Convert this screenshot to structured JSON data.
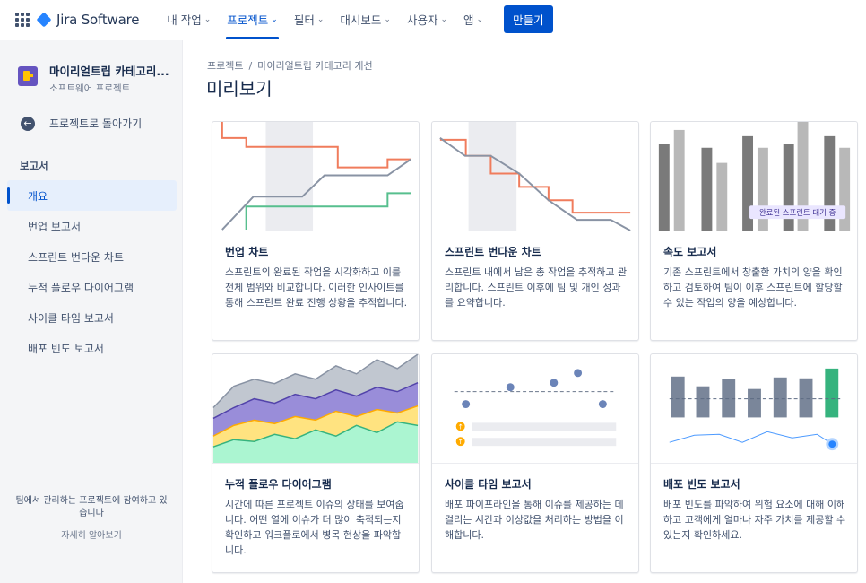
{
  "topnav": {
    "brand": "Jira Software",
    "items": [
      {
        "label": "내 작업",
        "active": false
      },
      {
        "label": "프로젝트",
        "active": true
      },
      {
        "label": "필터",
        "active": false
      },
      {
        "label": "대시보드",
        "active": false
      },
      {
        "label": "사용자",
        "active": false
      },
      {
        "label": "앱",
        "active": false
      }
    ],
    "create_label": "만들기",
    "chevron": "⌄"
  },
  "sidebar": {
    "project_name": "마이리얼트립 카테고리...",
    "project_type": "소프트웨어 프로젝트",
    "back_label": "프로젝트로 돌아가기",
    "section_title": "보고서",
    "items": [
      {
        "label": "개요",
        "active": true
      },
      {
        "label": "번업 보고서",
        "active": false
      },
      {
        "label": "스프린트 번다운 차트",
        "active": false
      },
      {
        "label": "누적 플로우 다이어그램",
        "active": false
      },
      {
        "label": "사이클 타임 보고서",
        "active": false
      },
      {
        "label": "배포 빈도 보고서",
        "active": false
      }
    ],
    "footer_text_1": "팀에서 관리하는 프로젝트에 참여하고 있",
    "footer_text_2": "습니다",
    "footer_link": "자세히 알아보기"
  },
  "main": {
    "breadcrumb": [
      "프로젝트",
      "마이리얼트립 카테고리 개선"
    ],
    "breadcrumb_sep": "/",
    "title": "미리보기"
  },
  "cards": [
    {
      "title": "번업 차트",
      "desc": "스프린트의 완료된 작업을 시각화하고 이를 전체 범위와 비교합니다. 이러한 인사이트를 통해 스프린트 완료 진행 상황을 추적합니다."
    },
    {
      "title": "스프린트 번다운 차트",
      "desc": "스프린트 내에서 남은 총 작업을 추적하고 관리합니다. 스프린트 이후에 팀 및 개인 성과를 요약합니다."
    },
    {
      "title": "속도 보고서",
      "desc": "기존 스프린트에서 창출한 가치의 양을 확인하고 검토하여 팀이 이후 스프린트에 할당할 수 있는 작업의 양을 예상합니다.",
      "badge": "완료된 스프린트 대기 중"
    },
    {
      "title": "누적 플로우 다이어그램",
      "desc": "시간에 따른 프로젝트 이슈의 상태를 보여줍니다. 어떤 열에 이슈가 더 많이 축적되는지 확인하고 워크플로에서 병목 현상을 파악합니다."
    },
    {
      "title": "사이클 타임 보고서",
      "desc": "배포 파이프라인을 통해 이슈를 제공하는 데 걸리는 시간과 이상값을 처리하는 방법을 이해합니다."
    },
    {
      "title": "배포 빈도 보고서",
      "desc": "배포 빈도를 파악하여 위험 요소에 대해 이해하고 고객에게 얼마나 자주 가치를 제공할 수 있는지 확인하세요."
    }
  ],
  "icons": {
    "app_switcher": "grid-icon",
    "back": "arrow-left-icon",
    "back_glyph": "←"
  },
  "colors": {
    "accent": "#0052cc",
    "burn_red": "#f07c5c",
    "burn_grey": "#8993a4",
    "burn_green": "#57bf8e",
    "cfd_grey": "#c1c7d0",
    "cfd_purple": "#8777d9",
    "cfd_yellow": "#ffe380",
    "cfd_green": "#79f2c0",
    "deploy_green": "#36b37e"
  }
}
